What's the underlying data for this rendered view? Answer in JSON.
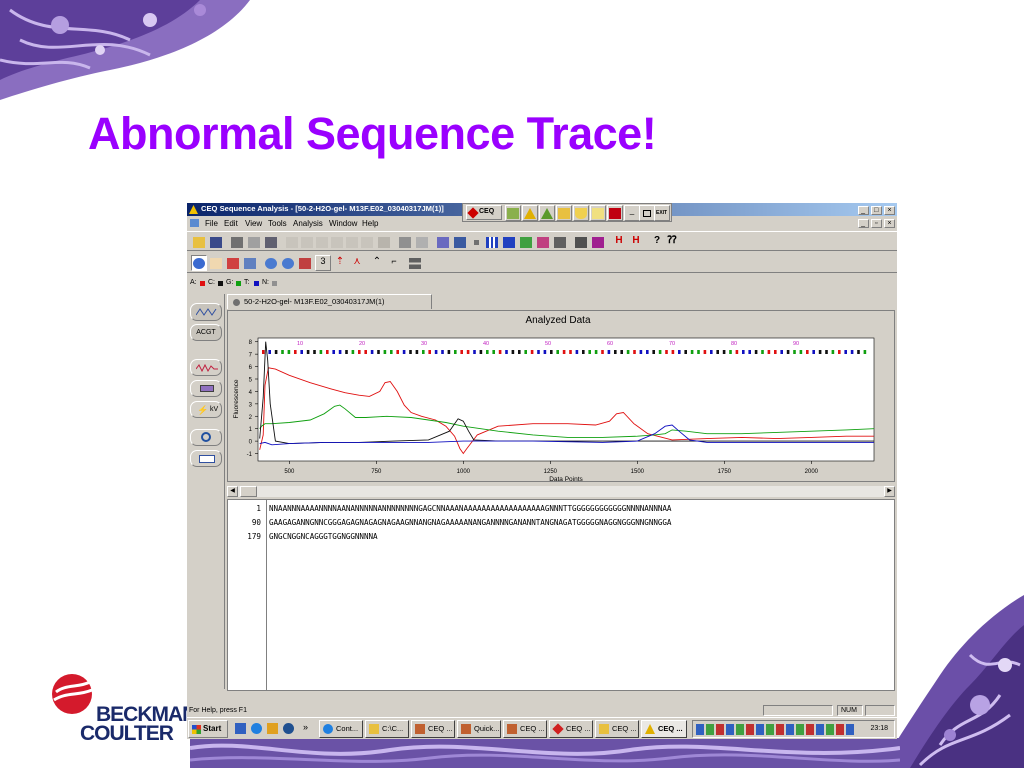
{
  "slide": {
    "title": "Abnormal Sequence Trace!"
  },
  "logo": {
    "line1": "BECKMAN",
    "line2": "COULTER"
  },
  "window": {
    "title": "CEQ Sequence Analysis - [50-2-H2O-gel- M13F.E02_03040317JM(1)]",
    "menu": [
      "File",
      "Edit",
      "View",
      "Tools",
      "Analysis",
      "Window",
      "Help"
    ],
    "toolbar_ceq": "CEQ",
    "toolbar_exit": "EXIT",
    "step_value": "3",
    "legend": {
      "a": "A:",
      "c": "C:",
      "g": "G:",
      "t": "T:",
      "n": "N:"
    },
    "tab_label": "50-2-H2O-gel- M13F.E02_03040317JM(1)",
    "side_buttons": [
      "ACGT",
      "kV"
    ],
    "status": "For Help, press F1",
    "num_indicator": "NUM"
  },
  "chart_data": {
    "type": "line",
    "title": "Analyzed Data",
    "xlabel": "Data Points",
    "ylabel": "Fluorescence",
    "xlim": [
      410,
      2180
    ],
    "ylim": [
      -1.6,
      8.3
    ],
    "x_ticks": [
      "500",
      "750",
      "1000",
      "1250",
      "1500",
      "1750",
      "2000"
    ],
    "y_ticks": [
      "8",
      "7",
      "6",
      "5",
      "4",
      "3",
      "2",
      "1",
      "0",
      "-1"
    ],
    "base_position_labels": [
      "10",
      "20",
      "30",
      "40",
      "50",
      "60",
      "70",
      "80",
      "90"
    ],
    "series": [
      {
        "color": "#e01010",
        "x": [
          415,
          425,
          430,
          440,
          460,
          500,
          560,
          620,
          660,
          700,
          730,
          760,
          775,
          790,
          810,
          830,
          850,
          880,
          920,
          950,
          975,
          990,
          1000,
          1010,
          1040,
          1100,
          1200,
          1300,
          1380,
          1420,
          1440,
          1460,
          1490,
          1530,
          1600,
          1700,
          1800,
          1900,
          2000,
          2100,
          2180
        ],
        "values": [
          -0.7,
          0.5,
          4.5,
          5.9,
          5.8,
          5.3,
          4.7,
          4.2,
          3.9,
          3.7,
          3.6,
          4.0,
          4.7,
          4.8,
          4.0,
          2.9,
          2.3,
          2.0,
          1.7,
          1.2,
          0.4,
          -0.6,
          -1.0,
          -0.6,
          0.5,
          1.2,
          1.4,
          1.4,
          1.3,
          1.6,
          2.2,
          2.3,
          1.4,
          0.6,
          0.1,
          0.2,
          0.3,
          0.2,
          0.3,
          0.4,
          0.4
        ]
      },
      {
        "color": "#10a010",
        "x": [
          415,
          420,
          430,
          450,
          500,
          560,
          600,
          630,
          645,
          660,
          690,
          720,
          780,
          850,
          900,
          950,
          1000,
          1100,
          1200,
          1300,
          1400,
          1500,
          1550,
          1580,
          1600,
          1640,
          1700,
          1750,
          1800,
          1900,
          2000,
          2100,
          2180
        ],
        "values": [
          1.0,
          1.2,
          1.4,
          1.4,
          1.5,
          1.7,
          2.2,
          2.8,
          2.9,
          2.6,
          1.9,
          1.9,
          2.0,
          1.9,
          1.7,
          1.5,
          1.2,
          0.8,
          0.5,
          0.3,
          0.3,
          0.4,
          0.5,
          0.6,
          0.9,
          0.8,
          0.6,
          0.6,
          0.6,
          0.7,
          0.8,
          0.9,
          1.0
        ]
      },
      {
        "color": "#101010",
        "x": [
          415,
          425,
          432,
          438,
          445,
          460,
          500,
          600,
          700,
          800,
          900,
          960,
          985,
          1000,
          1015,
          1030,
          1100,
          1300,
          1500,
          1700,
          1900,
          2100,
          2180
        ],
        "values": [
          0.2,
          3.5,
          8.0,
          6.5,
          3.0,
          0.0,
          -0.2,
          -0.1,
          -0.1,
          0.0,
          0.1,
          0.8,
          1.8,
          1.6,
          0.8,
          0.1,
          0.0,
          0.0,
          0.0,
          0.0,
          0.0,
          0.0,
          0.0
        ]
      },
      {
        "color": "#1010c0",
        "x": [
          415,
          430,
          450,
          500,
          600,
          700,
          800,
          900,
          1000,
          1200,
          1400,
          1500,
          1550,
          1580,
          1600,
          1620,
          1650,
          1700,
          1800,
          2000,
          2180
        ],
        "values": [
          -0.2,
          -0.1,
          -0.3,
          -0.2,
          -0.1,
          -0.1,
          -0.1,
          -0.1,
          0.0,
          0.0,
          -0.1,
          0.0,
          0.6,
          1.2,
          1.3,
          0.8,
          0.1,
          -0.1,
          -0.1,
          -0.1,
          -0.1
        ]
      }
    ]
  },
  "sequence": {
    "rows": [
      {
        "index": "1",
        "text": "NNAANNNAAAANNNNAANANNNNNANNNNNNNNGAGCNNAAANAAAAAAAAAAAAAAAAAAGNNNTTGGGGGGGGGGGGNNNNANNNAA"
      },
      {
        "index": "90",
        "text": "GAAGAGANNGNNCGGGAGAGNAGAGNAGAAGNNANGNAGAAAAANANGANNNNGANANNTANGNAGATGGGGGNAGGNGGGNNGNNGGA"
      },
      {
        "index": "179",
        "text": "GNGCNGGNCAGGGTGGNGGNNNNA"
      }
    ]
  },
  "taskbar": {
    "start": "Start",
    "tasks": [
      "Cont...",
      "C:\\C...",
      "CEQ ...",
      "Quick...",
      "CEQ ...",
      "CEQ ...",
      "CEQ ...",
      "CEQ ..."
    ],
    "chevron": "»",
    "clock": "23:18"
  }
}
